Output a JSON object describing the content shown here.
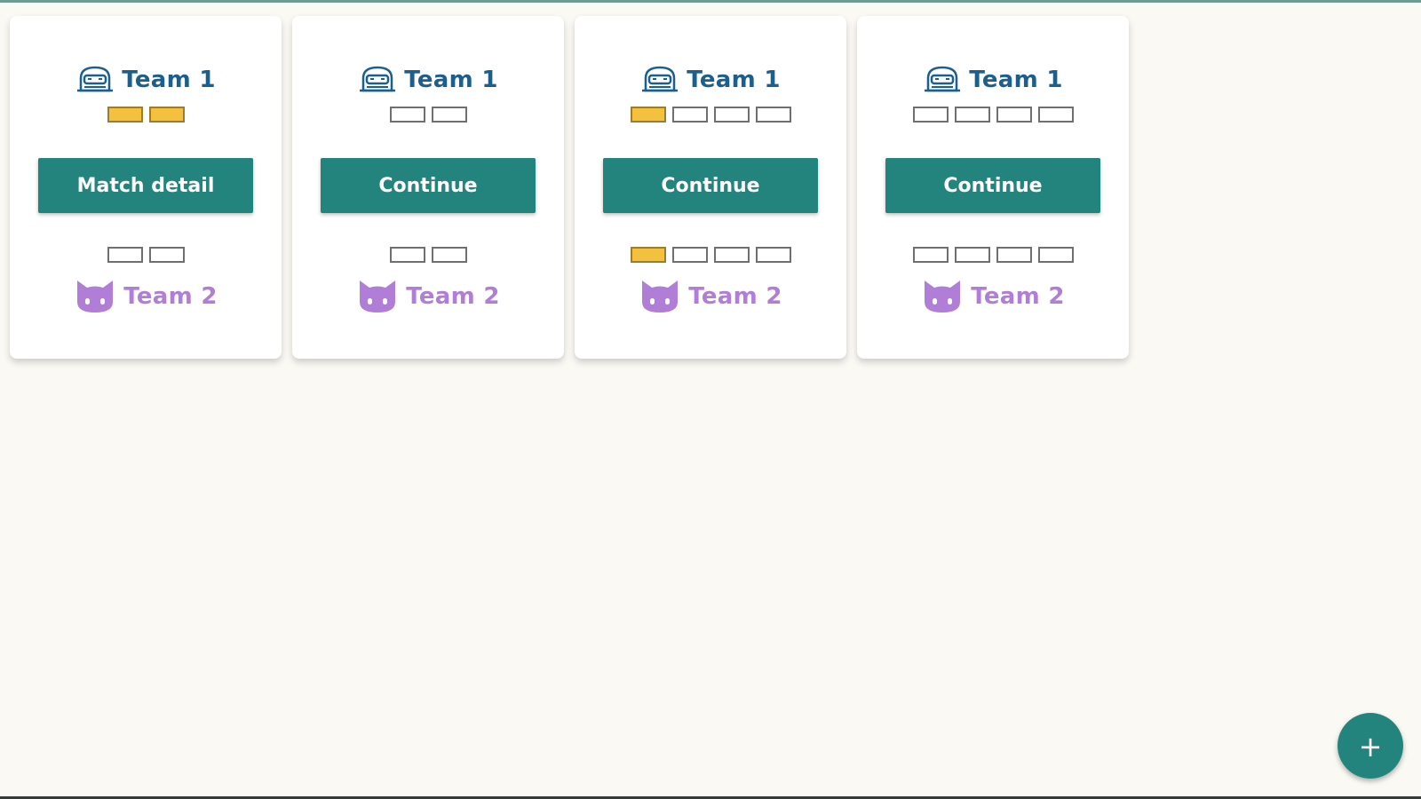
{
  "colors": {
    "accent": "#23847D",
    "team1": "#1B5F8E",
    "team2": "#B07ED6",
    "score_filled": "#F4C13F",
    "background": "#FAF9F4"
  },
  "icons": {
    "team1": "robot-helmet-icon",
    "team2": "cat-face-icon",
    "fab": "plus-icon"
  },
  "matches": [
    {
      "team1": {
        "name": "Team 1",
        "boxes": [
          true,
          true
        ]
      },
      "action_label": "Match detail",
      "team2": {
        "name": "Team 2",
        "boxes": [
          false,
          false
        ]
      }
    },
    {
      "team1": {
        "name": "Team 1",
        "boxes": [
          false,
          false
        ]
      },
      "action_label": "Continue",
      "team2": {
        "name": "Team 2",
        "boxes": [
          false,
          false
        ]
      }
    },
    {
      "team1": {
        "name": "Team 1",
        "boxes": [
          true,
          false,
          false,
          false
        ]
      },
      "action_label": "Continue",
      "team2": {
        "name": "Team 2",
        "boxes": [
          true,
          false,
          false,
          false
        ]
      }
    },
    {
      "team1": {
        "name": "Team 1",
        "boxes": [
          false,
          false,
          false,
          false
        ]
      },
      "action_label": "Continue",
      "team2": {
        "name": "Team 2",
        "boxes": [
          false,
          false,
          false,
          false
        ]
      }
    }
  ],
  "fab": {
    "label": "+"
  }
}
